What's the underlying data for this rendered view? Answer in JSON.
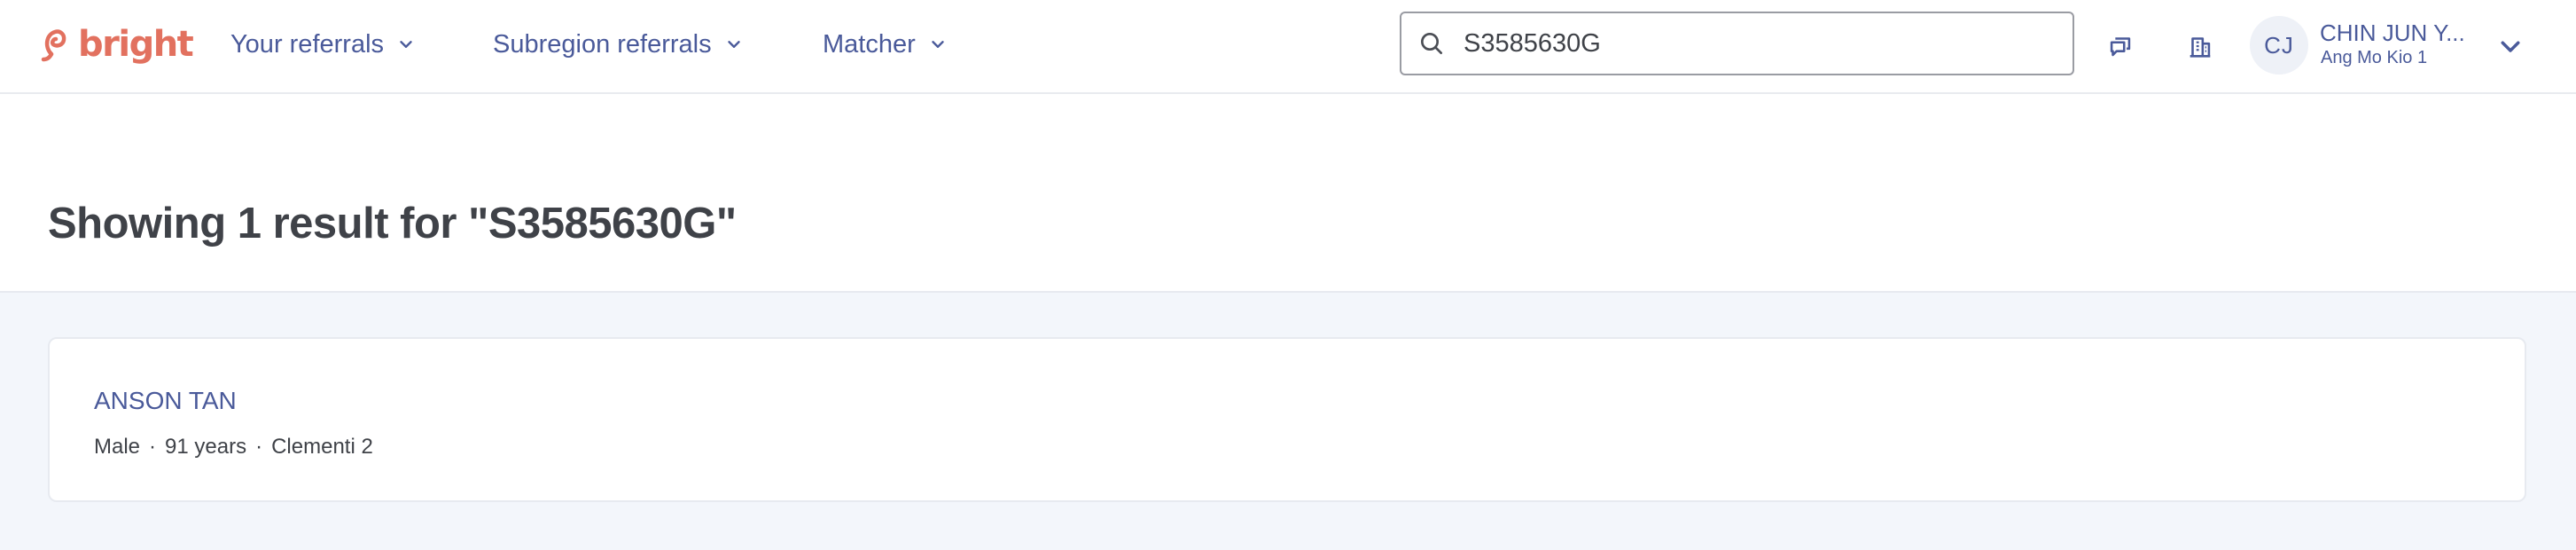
{
  "brand": {
    "name": "bright",
    "color": "#e2715f"
  },
  "nav": {
    "items": [
      {
        "label": "Your referrals"
      },
      {
        "label": "Subregion referrals"
      },
      {
        "label": "Matcher"
      }
    ]
  },
  "search": {
    "value": "S3585630G",
    "icon": "search-icon"
  },
  "toolbar": {
    "icons": [
      "chat-icon",
      "building-icon"
    ]
  },
  "user": {
    "initials": "CJ",
    "name": "CHIN JUN Y...",
    "subregion": "Ang Mo Kio 1"
  },
  "results": {
    "heading": "Showing 1 result for \"S3585630G\"",
    "items": [
      {
        "name": "ANSON TAN",
        "gender": "Male",
        "age": "91 years",
        "location": "Clementi 2",
        "separator": "·"
      }
    ]
  },
  "colors": {
    "accent": "#4a5a9a",
    "background": "#f3f6fb",
    "text": "#3f4248"
  }
}
